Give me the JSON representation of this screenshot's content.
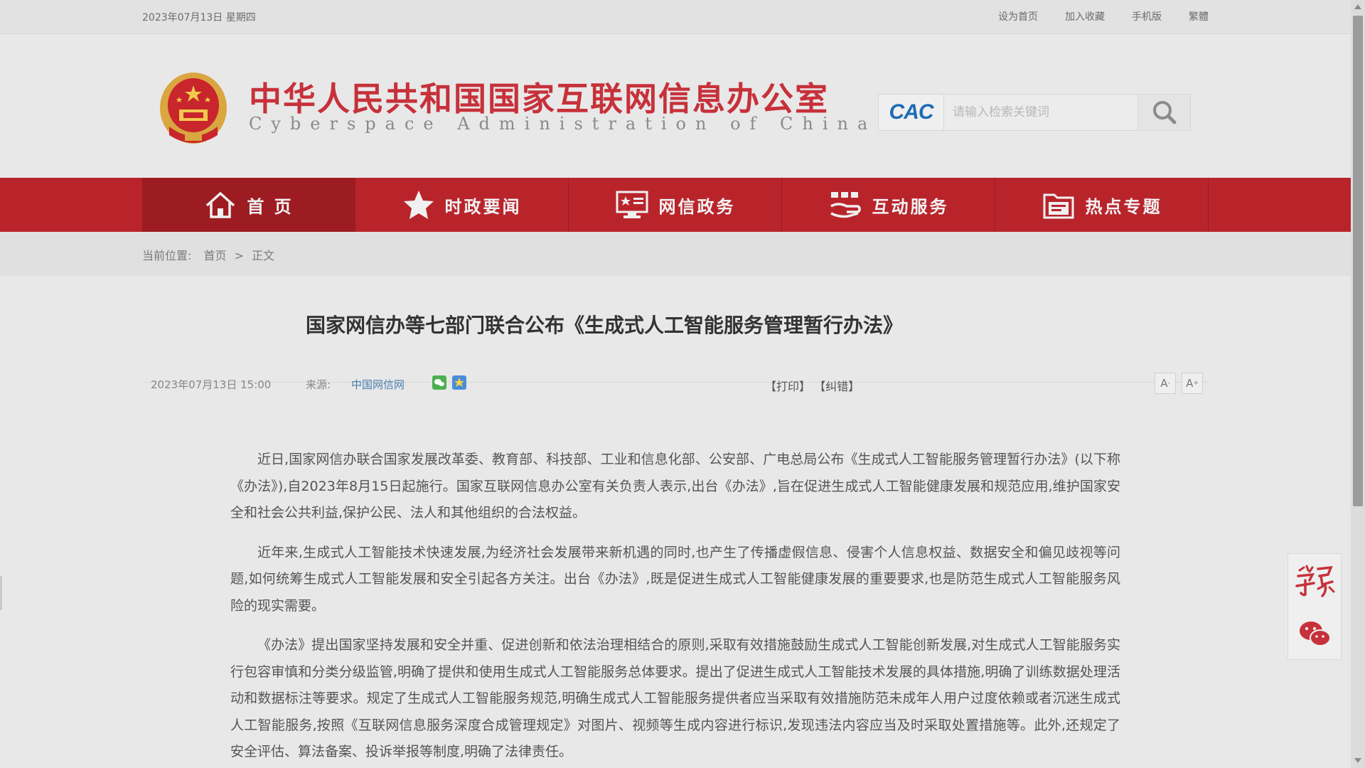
{
  "topbar": {
    "date": "2023年07月13日 星期四",
    "links": [
      "设为首页",
      "加入收藏",
      "手机版",
      "繁體"
    ]
  },
  "header": {
    "title_cn": "中华人民共和国国家互联网信息办公室",
    "title_en": "Cyberspace Administration of China",
    "search_logo": "CAC",
    "search_placeholder": "请输入检索关键词"
  },
  "nav": {
    "items": [
      {
        "label": "首 页",
        "icon": "home-icon"
      },
      {
        "label": "时政要闻",
        "icon": "star-icon"
      },
      {
        "label": "网信政务",
        "icon": "monitor-icon"
      },
      {
        "label": "互动服务",
        "icon": "handshake-icon"
      },
      {
        "label": "热点专题",
        "icon": "folder-icon"
      }
    ]
  },
  "breadcrumb": {
    "label": "当前位置:",
    "home": "首页",
    "sep": ">",
    "current": "正文"
  },
  "article": {
    "title": "国家网信办等七部门联合公布《生成式人工智能服务管理暂行办法》",
    "time": "2023年07月13日 15:00",
    "source_label": "来源:",
    "source": "中国网信网",
    "print": "【打印】",
    "correct": "【纠错】",
    "font_small": "A",
    "font_large": "A",
    "paragraphs": [
      "近日,国家网信办联合国家发展改革委、教育部、科技部、工业和信息化部、公安部、广电总局公布《生成式人工智能服务管理暂行办法》(以下称《办法》),自2023年8月15日起施行。国家互联网信息办公室有关负责人表示,出台《办法》,旨在促进生成式人工智能健康发展和规范应用,维护国家安全和社会公共利益,保护公民、法人和其他组织的合法权益。",
      "近年来,生成式人工智能技术快速发展,为经济社会发展带来新机遇的同时,也产生了传播虚假信息、侵害个人信息权益、数据安全和偏见歧视等问题,如何统筹生成式人工智能发展和安全引起各方关注。出台《办法》,既是促进生成式人工智能健康发展的重要要求,也是防范生成式人工智能服务风险的现实需要。",
      "《办法》提出国家坚持发展和安全并重、促进创新和依法治理相结合的原则,采取有效措施鼓励生成式人工智能创新发展,对生成式人工智能服务实行包容审慎和分类分级监管,明确了提供和使用生成式人工智能服务总体要求。提出了促进生成式人工智能技术发展的具体措施,明确了训练数据处理活动和数据标注等要求。规定了生成式人工智能服务规范,明确生成式人工智能服务提供者应当采取有效措施防范未成年人用户过度依赖或者沉迷生成式人工智能服务,按照《互联网信息服务深度合成管理规定》对图片、视频等生成内容进行标识,发现违法内容应当及时采取处置措施等。此外,还规定了安全评估、算法备案、投诉举报等制度,明确了法律责任。"
    ]
  },
  "colors": {
    "brand_red": "#b9242b",
    "title_red": "#c7313a",
    "link_blue": "#4a7fb0"
  }
}
